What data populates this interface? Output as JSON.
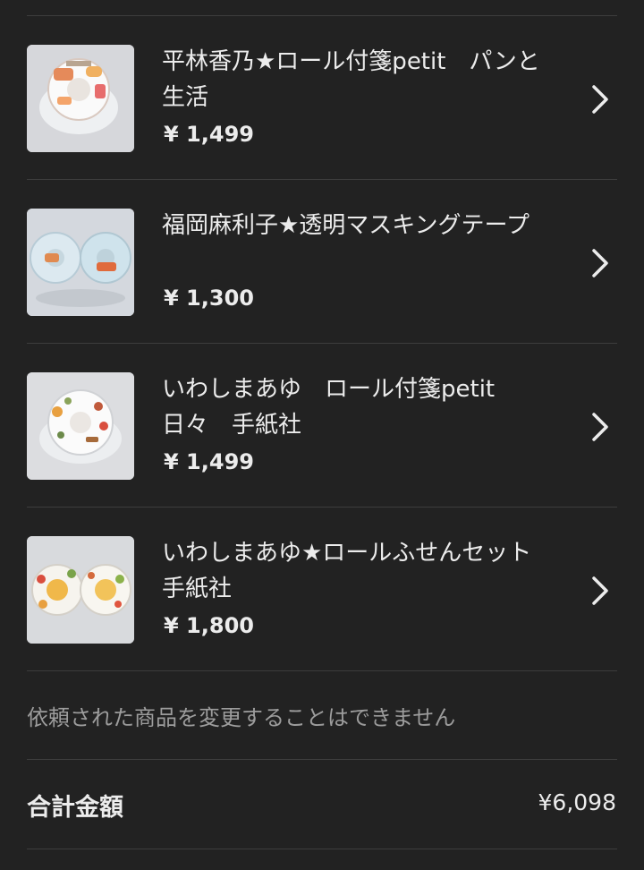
{
  "items": [
    {
      "title": "平林香乃★ロール付箋petit　パンと生活",
      "price": "¥ 1,499",
      "image": "bread-washi-tape-thumbnail"
    },
    {
      "title": "福岡麻利子★透明マスキングテープ",
      "price": "¥ 1,300",
      "image": "clear-masking-tape-thumbnail"
    },
    {
      "title": "いわしまあゆ　ロール付箋petit　日々　手紙社",
      "price": "¥ 1,499",
      "image": "daily-washi-tape-thumbnail"
    },
    {
      "title": "いわしまあゆ★ロールふせんセット　手紙社",
      "price": "¥ 1,800",
      "image": "sticky-roll-set-thumbnail"
    }
  ],
  "notice": "依頼された商品を変更することはできません",
  "total": {
    "label": "合計金額",
    "value": "¥6,098"
  },
  "colors": {
    "background": "#222222",
    "text": "#ececec",
    "muted": "#9c9c9c",
    "divider": "#3d3d3d"
  },
  "icons": {
    "row_action": "chevron-right-icon"
  }
}
